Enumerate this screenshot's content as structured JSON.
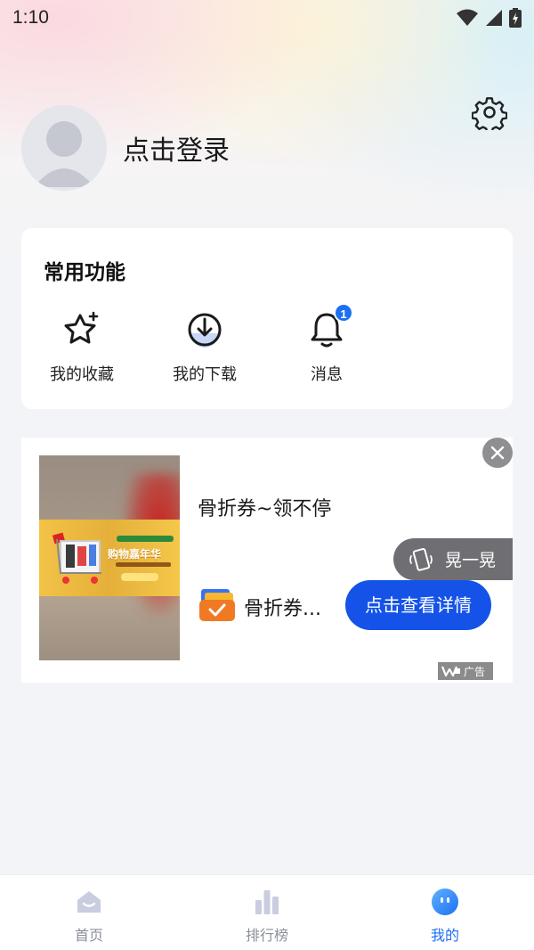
{
  "status_bar": {
    "time": "1:10"
  },
  "profile": {
    "login_label": "点击登录"
  },
  "functions_card": {
    "title": "常用功能",
    "items": [
      {
        "label": "我的收藏",
        "icon": "star-icon"
      },
      {
        "label": "我的下载",
        "icon": "download-icon"
      },
      {
        "label": "消息",
        "icon": "bell-icon",
        "badge": "1"
      }
    ]
  },
  "ad": {
    "title": "骨折券~领不停",
    "promo_text": "购物嘉年华",
    "shake_label": "晃一晃",
    "brand_name": "骨折券...",
    "cta_label": "点击查看详情",
    "ad_mark": "广告"
  },
  "tabbar": {
    "items": [
      {
        "label": "首页",
        "icon": "home-icon",
        "active": false
      },
      {
        "label": "排行榜",
        "icon": "ranking-icon",
        "active": false
      },
      {
        "label": "我的",
        "icon": "profile-icon",
        "active": true
      }
    ]
  },
  "colors": {
    "accent": "#1d6ff2",
    "cta": "#1553e8",
    "background": "#f3f4f7"
  }
}
